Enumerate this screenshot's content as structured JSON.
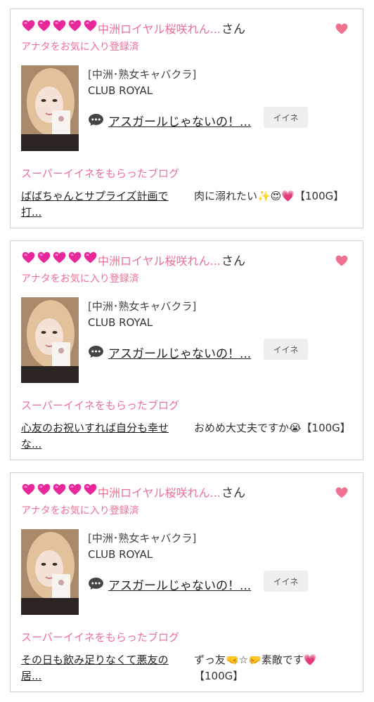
{
  "colors": {
    "accent_pink": "#ee6f93",
    "heart_magenta": "#e8289a",
    "border": "#cfcfcf",
    "button_bg": "#efefef"
  },
  "cards": [
    {
      "rank_hearts": 5,
      "name": "中洲ロイヤル桜咲れん...",
      "honorific": "さん",
      "favorite_note": "アナタをお気に入り登録済",
      "shop_type": "[中洲･熟女キャバクラ]",
      "shop_name": "CLUB ROYAL",
      "blog_title": "アスガールじゃないの！...",
      "iine_label": "イイネ",
      "super_label": "スーパーイイネをもらったブログ",
      "super_blog": "ばばちゃんとサプライズ計画で打...",
      "comment": "肉に溺れたい✨😍💗【100G】"
    },
    {
      "rank_hearts": 5,
      "name": "中洲ロイヤル桜咲れん...",
      "honorific": "さん",
      "favorite_note": "アナタをお気に入り登録済",
      "shop_type": "[中洲･熟女キャバクラ]",
      "shop_name": "CLUB ROYAL",
      "blog_title": "アスガールじゃないの！...",
      "iine_label": "イイネ",
      "super_label": "スーパーイイネをもらったブログ",
      "super_blog": "心友のお祝いすれば自分も幸せな...",
      "comment": "おめめ大丈夫ですか😭【100G】"
    },
    {
      "rank_hearts": 5,
      "name": "中洲ロイヤル桜咲れん...",
      "honorific": "さん",
      "favorite_note": "アナタをお気に入り登録済",
      "shop_type": "[中洲･熟女キャバクラ]",
      "shop_name": "CLUB ROYAL",
      "blog_title": "アスガールじゃないの！...",
      "iine_label": "イイネ",
      "super_label": "スーパーイイネをもらったブログ",
      "super_blog": "その日も飲み足りなくて悪友の居...",
      "comment": "ずっ友🤜☆🤛素敵です💗【100G】"
    }
  ]
}
